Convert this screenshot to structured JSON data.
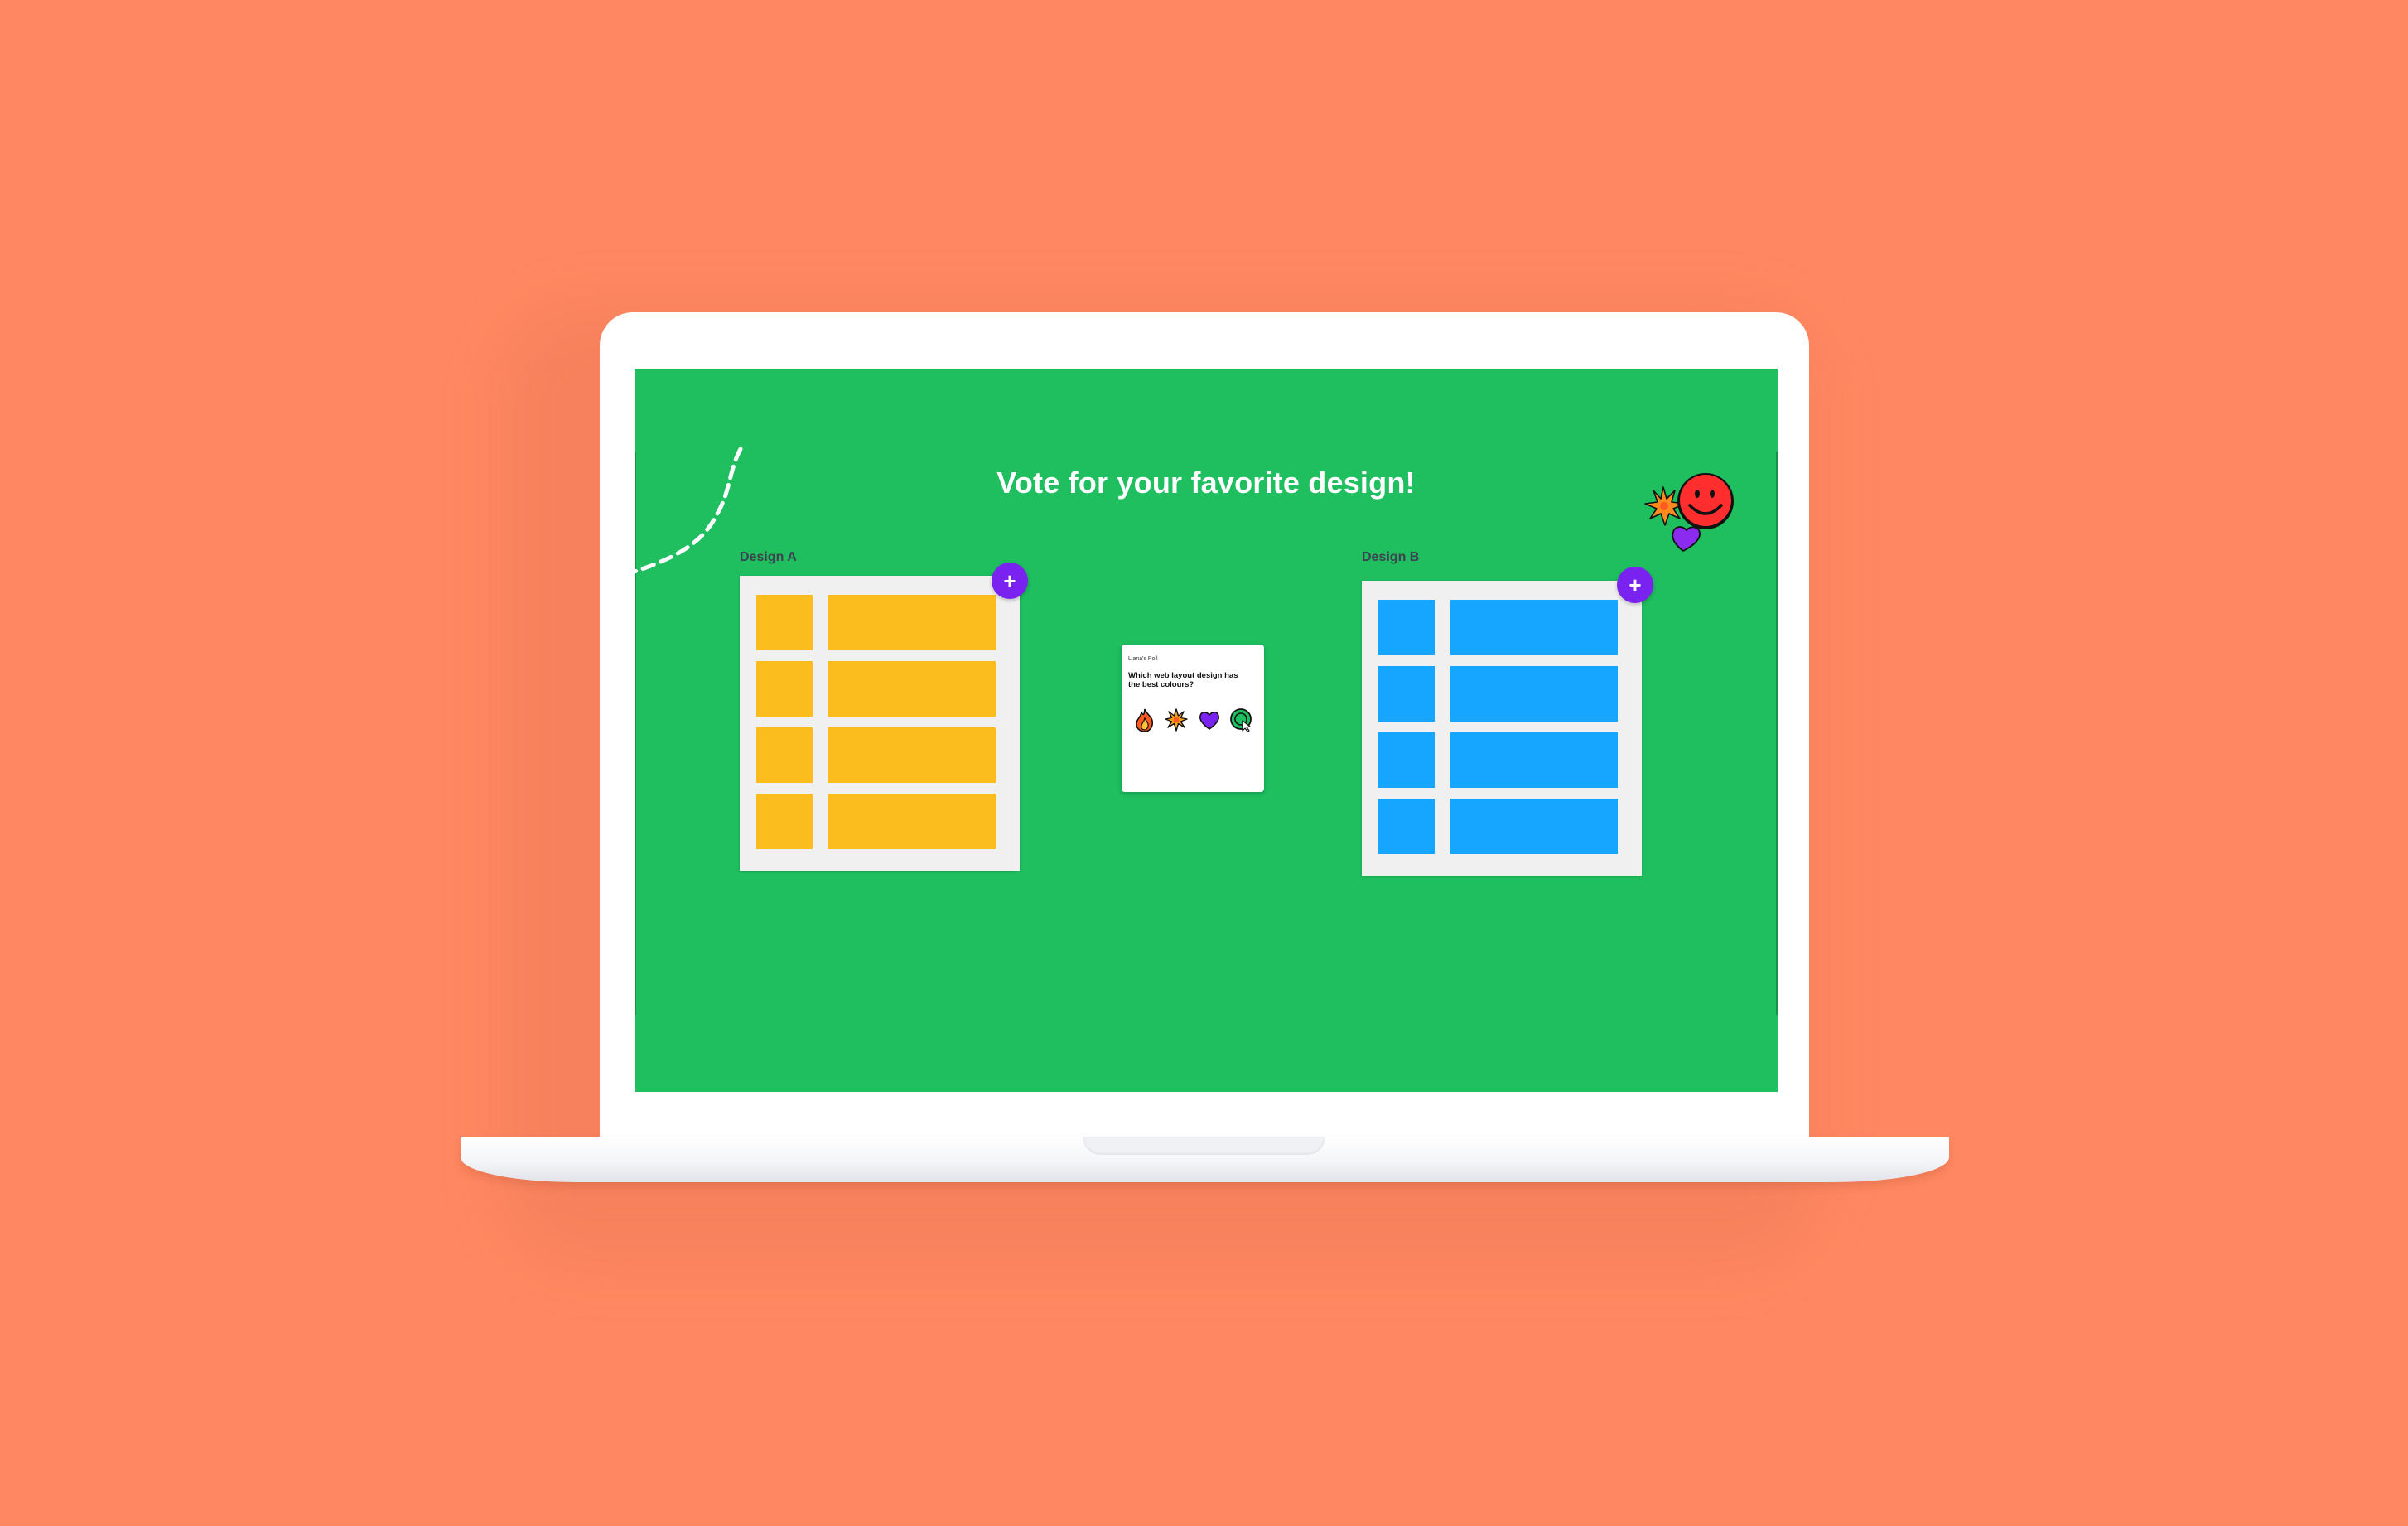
{
  "board": {
    "title": "Vote for your favorite design!"
  },
  "designs": [
    {
      "label": "Design A",
      "color": "#FBBC1E",
      "add_label": "+"
    },
    {
      "label": "Design B",
      "color": "#17A6FF",
      "add_label": "+"
    }
  ],
  "poll": {
    "author": "Liana's Poll",
    "question": "Which web layout design has the best colours?",
    "reactions": [
      "fire-icon",
      "explosion-icon",
      "heart-icon",
      "add-reaction-icon"
    ]
  },
  "stickers": [
    "explosion-sticker",
    "smiley-sticker",
    "heart-sticker"
  ],
  "colors": {
    "background": "#FF8862",
    "board": "#1FBE5F",
    "add_button": "#7A22F0"
  }
}
